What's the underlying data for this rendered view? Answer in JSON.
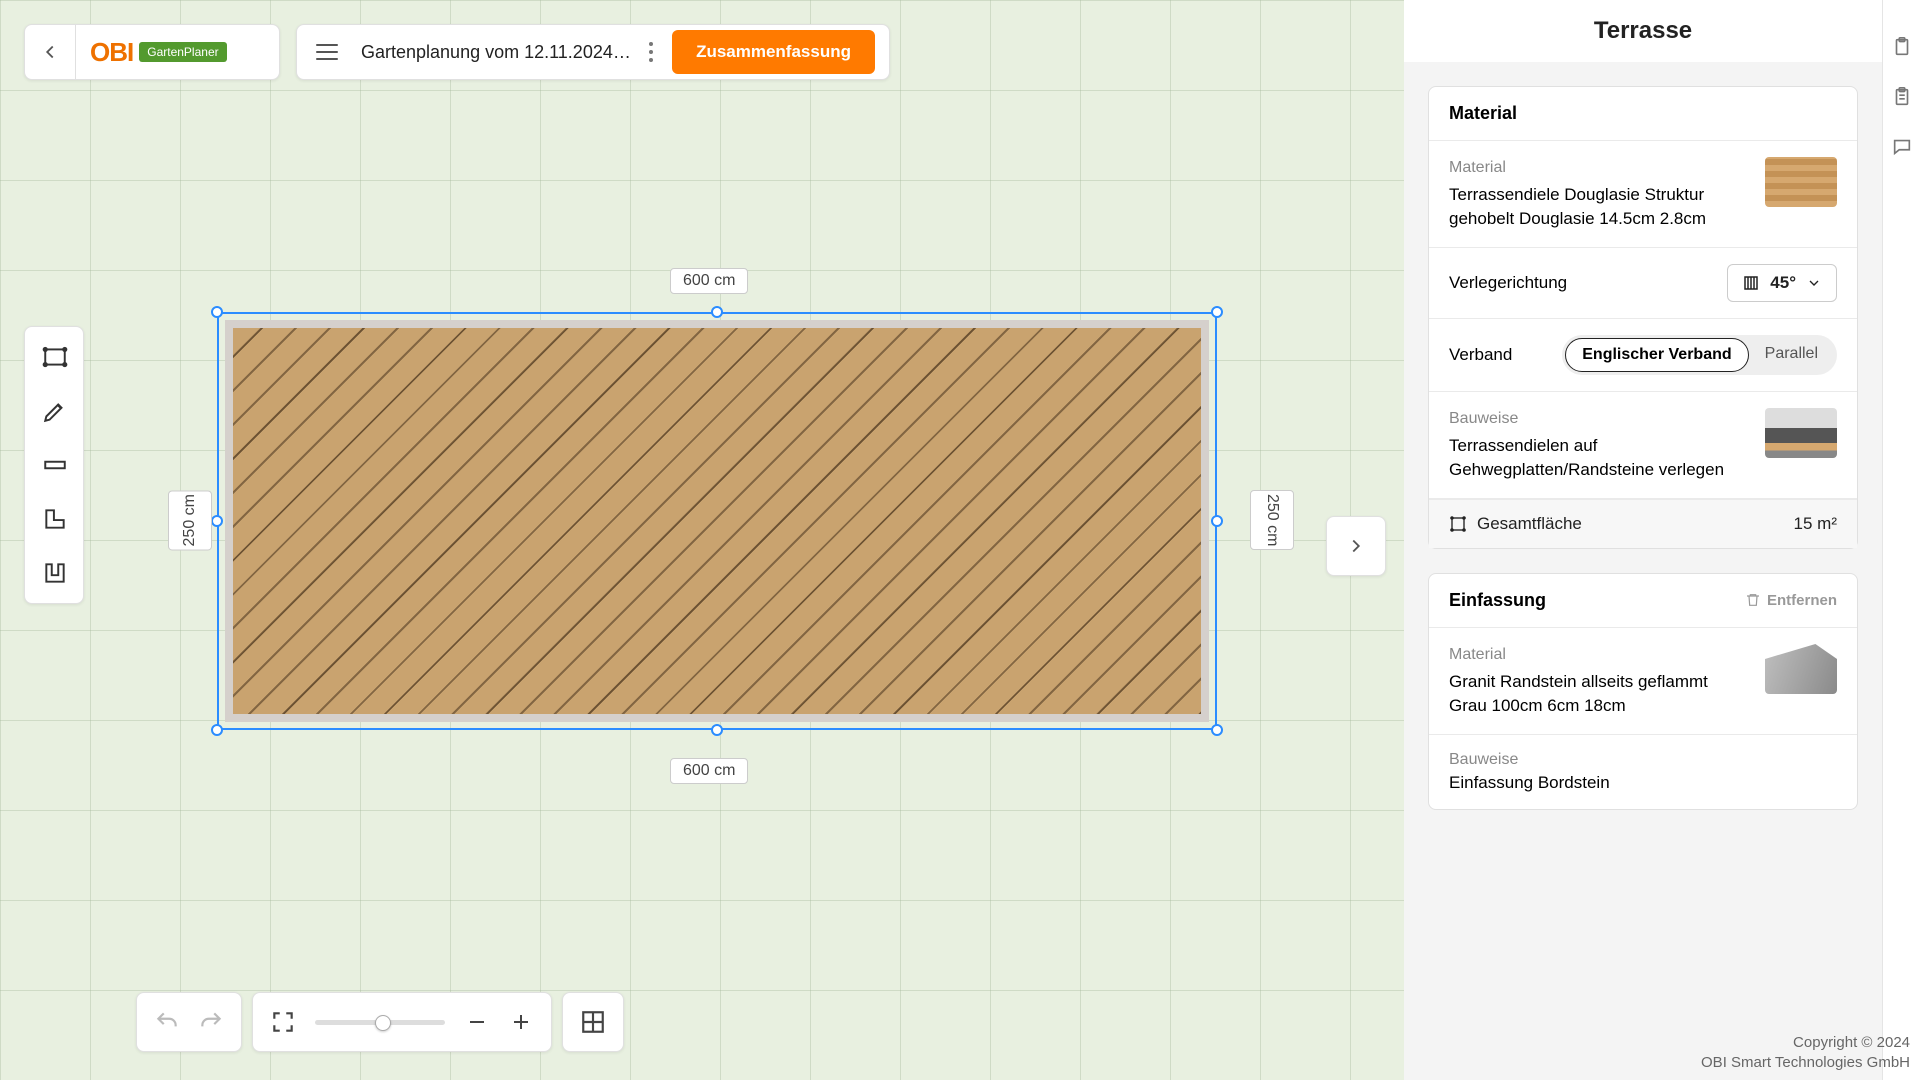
{
  "header": {
    "brand_primary": "OBI",
    "brand_badge": "GartenPlaner",
    "project_name": "Gartenplanung vom 12.11.2024 1...",
    "summary_button": "Zusammenfassung"
  },
  "canvas": {
    "dim_top": "600 cm",
    "dim_bottom": "600 cm",
    "dim_left": "250 cm",
    "dim_right": "250 cm"
  },
  "sidebar": {
    "title": "Terrasse",
    "material_card": {
      "heading": "Material",
      "material_label": "Material",
      "material_value": "Terrassendiele Douglasie Struktur gehobelt Douglasie 14.5cm 2.8cm",
      "direction_label": "Verlegerichtung",
      "direction_value": "45°",
      "bond_label": "Verband",
      "bond_options": [
        "Englischer Verband",
        "Parallel"
      ],
      "bond_selected": "Englischer Verband",
      "build_label": "Bauweise",
      "build_value": "Terrassendielen auf Gehwegplatten/Randsteine verlegen",
      "area_label": "Gesamtfläche",
      "area_value": "15 m²"
    },
    "edging_card": {
      "heading": "Einfassung",
      "remove": "Entfernen",
      "material_label": "Material",
      "material_value": "Granit Randstein allseits geflammt Grau 100cm 6cm 18cm",
      "build_label": "Bauweise",
      "build_value": "Einfassung Bordstein"
    }
  },
  "footer": {
    "copyright1": "Copyright © 2024",
    "copyright2": "OBI Smart Technologies GmbH"
  }
}
